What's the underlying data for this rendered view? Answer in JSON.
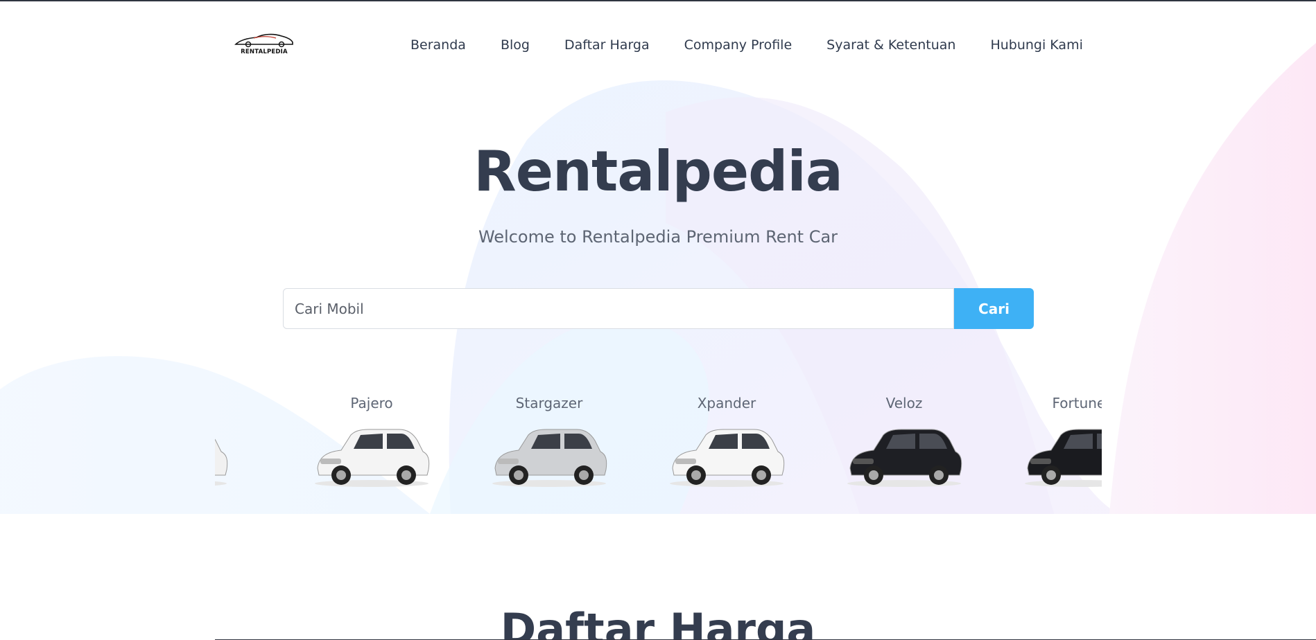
{
  "brand": {
    "name": "Rentalpedia",
    "logo_text": "RENTALPEDIA"
  },
  "nav": {
    "items": [
      {
        "label": "Beranda"
      },
      {
        "label": "Blog"
      },
      {
        "label": "Daftar Harga"
      },
      {
        "label": "Company Profile"
      },
      {
        "label": "Syarat & Ketentuan"
      },
      {
        "label": "Hubungi Kami"
      }
    ]
  },
  "hero": {
    "title": "Rentalpedia",
    "subtitle": "Welcome to Rentalpedia Premium Rent Car"
  },
  "search": {
    "placeholder": "Cari Mobil",
    "button_label": "Cari"
  },
  "cars": [
    {
      "name": "",
      "color": "#f1f1f1"
    },
    {
      "name": "Pajero",
      "color": "#f4f4f4"
    },
    {
      "name": "Stargazer",
      "color": "#cfd1d4"
    },
    {
      "name": "Xpander",
      "color": "#f6f6f6"
    },
    {
      "name": "Veloz",
      "color": "#1e1f24"
    },
    {
      "name": "Fortuner",
      "color": "#1a1b1f"
    }
  ],
  "sections": {
    "price_list_title": "Daftar Harga"
  },
  "colors": {
    "accent": "#3eb1f5",
    "heading": "#343d4f",
    "text": "#5d6573"
  }
}
